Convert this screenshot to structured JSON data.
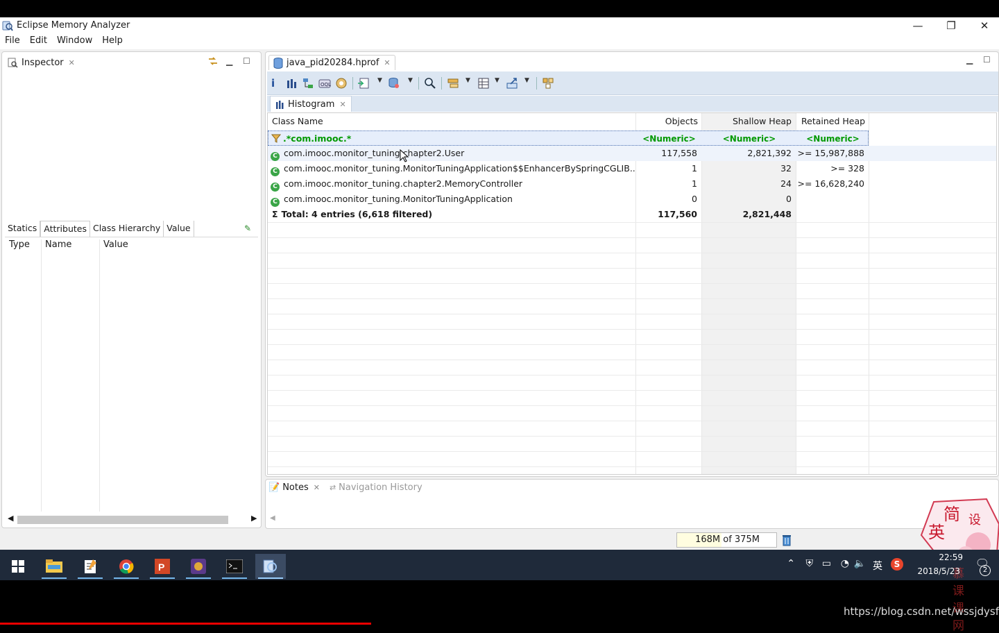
{
  "window": {
    "title": "Eclipse Memory Analyzer",
    "minimize": "—",
    "restore": "❐",
    "close": "✕"
  },
  "menu": [
    "File",
    "Edit",
    "Window",
    "Help"
  ],
  "inspector": {
    "tab_label": "Inspector",
    "subtabs": [
      "Statics",
      "Attributes",
      "Class Hierarchy",
      "Value"
    ],
    "active_subtab": "Attributes",
    "columns": [
      "Type",
      "Name",
      "Value"
    ]
  },
  "editor": {
    "file_tab": "java_pid20284.hprof",
    "histogram_tab": "Histogram",
    "columns": [
      "Class Name",
      "Objects",
      "Shallow Heap",
      "Retained Heap"
    ],
    "filter_row": {
      "class": ".*com.imooc.*",
      "objects": "<Numeric>",
      "shallow": "<Numeric>",
      "retained": "<Numeric>"
    },
    "rows": [
      {
        "class": "com.imooc.monitor_tuning.chapter2.User",
        "objects": "117,558",
        "shallow": "2,821,392",
        "retained": ">= 15,987,888"
      },
      {
        "class": "com.imooc.monitor_tuning.MonitorTuningApplication$$EnhancerBySpringCGLIB...",
        "objects": "1",
        "shallow": "32",
        "retained": ">= 328"
      },
      {
        "class": "com.imooc.monitor_tuning.chapter2.MemoryController",
        "objects": "1",
        "shallow": "24",
        "retained": ">= 16,628,240"
      },
      {
        "class": "com.imooc.monitor_tuning.MonitorTuningApplication",
        "objects": "0",
        "shallow": "0",
        "retained": ""
      }
    ],
    "total": {
      "label": "Total: 4 entries (6,618 filtered)",
      "objects": "117,560",
      "shallow": "2,821,448"
    }
  },
  "notes": {
    "notes_tab": "Notes",
    "nav_tab": "Navigation History"
  },
  "heap_status": {
    "used": "168M",
    "of_label": "of 375M",
    "fraction": 0.45
  },
  "seal": {
    "chars": [
      "简",
      "设",
      "英"
    ]
  },
  "taskbar": {
    "ime": "英",
    "time": "22:59",
    "date": "2018/5/23",
    "notifications": "2",
    "overlay_text": "慕课课网"
  },
  "watermark": "https://blog.csdn.net/wssjdysf1"
}
